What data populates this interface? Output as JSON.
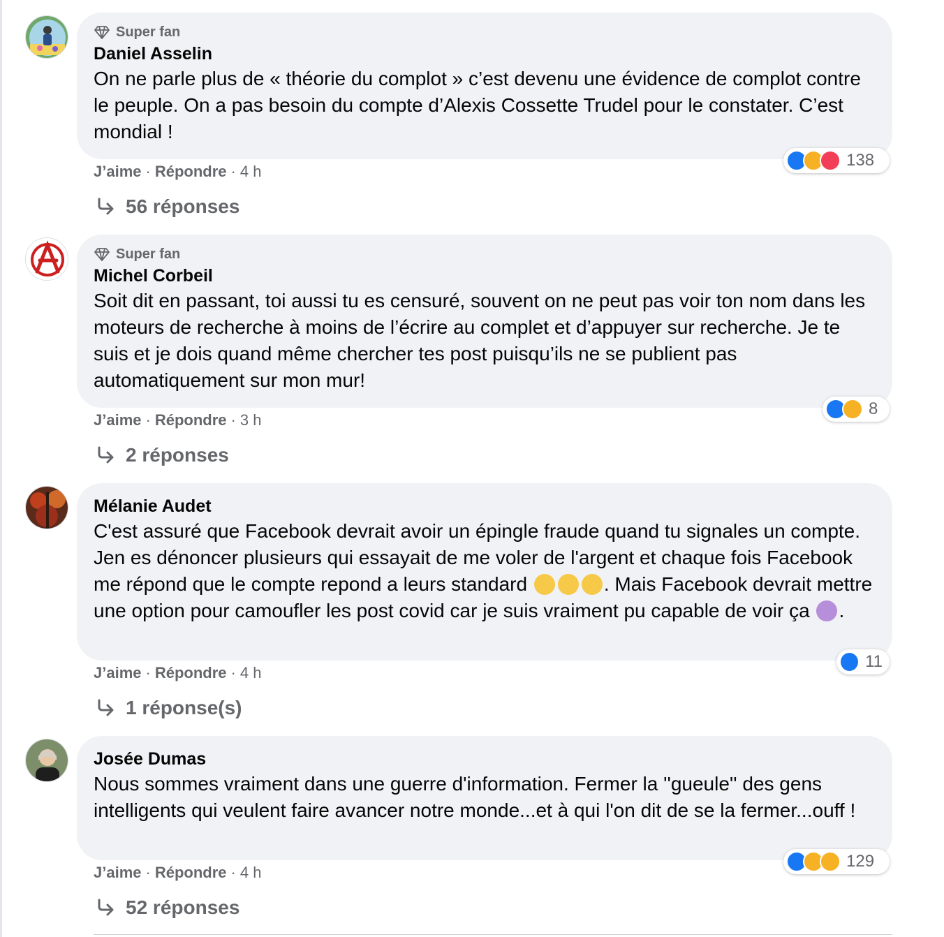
{
  "comments": [
    {
      "badge": "Super fan",
      "author": "Daniel Asselin",
      "text": "On ne parle plus de « théorie du complot » c’est devenu une évidence de complot contre le peuple. On a pas besoin du compte d’Alexis Cossette Trudel pour le constater. C’est mondial !",
      "like": "J’aime",
      "reply": "Répondre",
      "time": "4 h",
      "reaction_count": "138",
      "replies": "56 réponses"
    },
    {
      "badge": "Super fan",
      "author": "Michel Corbeil",
      "text": "Soit dit en passant, toi aussi tu es censuré, souvent on ne peut pas voir ton nom dans les moteurs de recherche à moins de l’écrire au complet et d’appuyer sur recherche. Je te suis et je dois quand même chercher tes post puisqu’ils ne se publient pas automatiquement sur mon mur!",
      "like": "J’aime",
      "reply": "Répondre",
      "time": "3 h",
      "reaction_count": "8",
      "replies": "2 réponses"
    },
    {
      "author": "Mélanie Audet",
      "text_a": "C'est assuré que Facebook devrait avoir un épingle fraude quand tu signales un compte. Jen es dénoncer plusieurs qui essayait de me voler de l'argent et chaque fois Facebook me répond que le compte repond a leurs standard",
      "text_b": ". Mais Facebook devrait mettre une option pour camoufler les post covid car je suis vraiment pu capable de voir ça",
      "text_c": ".",
      "like": "J’aime",
      "reply": "Répondre",
      "time": "4 h",
      "reaction_count": "11",
      "replies": "1 réponse(s)"
    },
    {
      "author": "Josée Dumas",
      "text": "Nous sommes vraiment dans une guerre d'information. Fermer la ''gueule'' des gens intelligents qui veulent faire avancer notre monde...et à qui l'on dit de se la fermer...ouff !",
      "like": "J’aime",
      "reply": "Répondre",
      "time": "4 h",
      "reaction_count": "129",
      "replies": "52 réponses"
    }
  ],
  "colors": {
    "bubble": "#f0f2f5",
    "secondary_text": "#65676b",
    "like_blue": "#1877f2",
    "haha_yellow": "#f7b125",
    "love_red": "#f33e58"
  },
  "icons": [
    "diamond-icon",
    "reply-arrow-icon",
    "like-reaction-icon",
    "haha-reaction-icon",
    "love-reaction-icon",
    "care-reaction-icon",
    "eye-roll-emoji",
    "facepalm-emoji"
  ]
}
